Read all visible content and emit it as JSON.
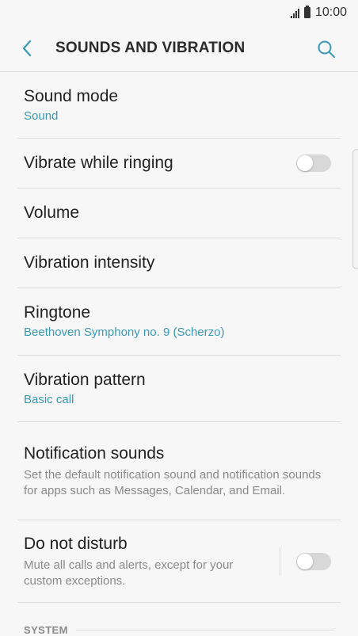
{
  "status_bar": {
    "time": "10:00"
  },
  "header": {
    "title": "SOUNDS AND VIBRATION"
  },
  "items": [
    {
      "label": "Sound mode",
      "sub": "Sound"
    },
    {
      "label": "Vibrate while ringing",
      "toggle": false
    },
    {
      "label": "Volume"
    },
    {
      "label": "Vibration intensity"
    },
    {
      "label": "Ringtone",
      "sub": "Beethoven Symphony no. 9 (Scherzo)"
    },
    {
      "label": "Vibration pattern",
      "sub": "Basic call"
    },
    {
      "label": "Notification sounds",
      "desc": "Set the default notification sound and notification sounds for apps such as Messages, Calendar, and Email."
    },
    {
      "label": "Do not disturb",
      "desc": "Mute all calls and alerts, except for your custom exceptions.",
      "toggle": false
    }
  ],
  "section": {
    "title": "SYSTEM"
  },
  "colors": {
    "accent": "#3a9ab5",
    "toggle_off": "#d8d8d8",
    "background": "#f7f7f7"
  }
}
